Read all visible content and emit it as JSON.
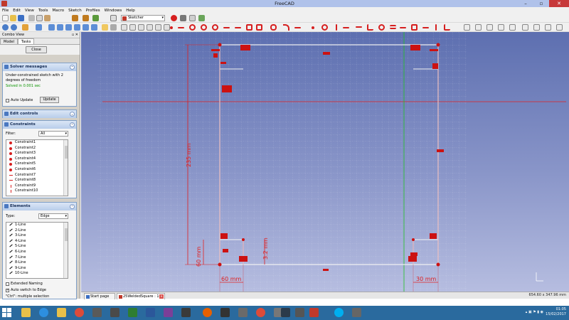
{
  "window": {
    "title": "FreeCAD"
  },
  "menu": [
    "File",
    "Edit",
    "View",
    "Tools",
    "Macro",
    "Sketch",
    "Profiles",
    "Windows",
    "Help"
  ],
  "toolbar": {
    "workbench": "Sketcher"
  },
  "combo": {
    "title": "Combo View",
    "tabs": [
      "Model",
      "Tasks"
    ],
    "close_label": "Close"
  },
  "solver": {
    "title": "Solver messages",
    "message": "Under-constrained sketch with 2 degrees of freedom",
    "status": "Solved in 0.001 sec",
    "auto_update_label": "Auto Update",
    "update_label": "Update"
  },
  "edit_controls": {
    "title": "Edit controls"
  },
  "constraints": {
    "title": "Constraints",
    "filter_label": "Filter:",
    "filter_value": "All",
    "items": [
      "Constraint1",
      "Constraint2",
      "Constraint3",
      "Constraint4",
      "Constraint5",
      "Constraint6",
      "Constraint7",
      "Constraint8",
      "Constraint9",
      "Constraint10"
    ]
  },
  "elements": {
    "title": "Elements",
    "type_label": "Type:",
    "type_value": "Edge",
    "items": [
      "1-Line",
      "2-Line",
      "3-Line",
      "4-Line",
      "5-Line",
      "6-Line",
      "7-Line",
      "8-Line",
      "9-Line",
      "10-Line"
    ],
    "extended_naming": "Extended Naming",
    "auto_switch": "Auto switch to Edge",
    "multiple_selection": "\"Ctrl\": multiple selection"
  },
  "dimensions": {
    "vertical_main": "235 mm",
    "left_small": "60 mm",
    "middle_small": "3.2 mm",
    "bottom_left": "60 mm",
    "bottom_right": "30 mm"
  },
  "doc_tabs": [
    "Start page",
    "25WeldedSquare : 1"
  ],
  "status": {
    "dims": "654.60 x 347.96 mm"
  },
  "clock": {
    "time": "01:05",
    "date": "15/02/2017"
  },
  "colors": {
    "sketch_red": "#e02020",
    "constraint_red": "#cc1111",
    "view_top": "#5d6fb0",
    "view_bottom": "#b6bde0",
    "taskbar": "#2a6a9e"
  }
}
